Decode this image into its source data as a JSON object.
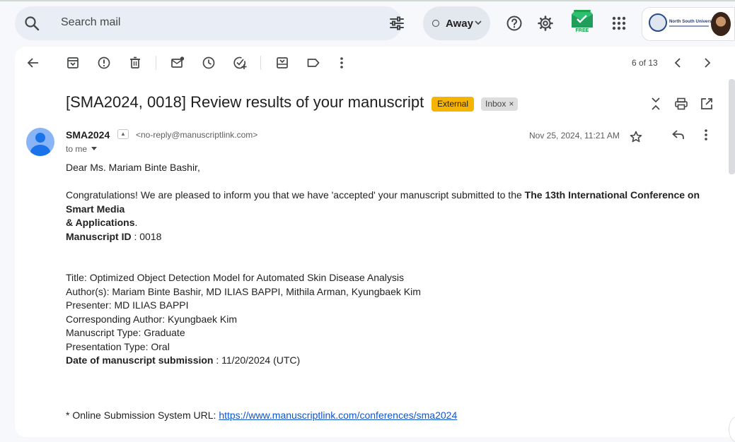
{
  "header": {
    "search_placeholder": "Search mail",
    "status": "Away",
    "free_badge": "FREE",
    "org_name": "North South University"
  },
  "toolbar": {
    "counter": "6 of 13"
  },
  "email": {
    "subject": "[SMA2024, 0018] Review results of your manuscript",
    "labels": {
      "external": "External",
      "inbox": "Inbox",
      "remove": "×"
    },
    "sender_name": "SMA2024",
    "sender_email": "<no-reply@manuscriptlink.com>",
    "recipient": "to me",
    "date": "Nov 25, 2024, 11:21 AM",
    "greeting": "Dear Ms. Mariam Binte Bashir,",
    "para1_text": "Congratulations! We are pleased to inform you that we have 'accepted' your manuscript submitted to the ",
    "para1_bold1": "The 13th International Conference on Smart Media",
    "para1_bold2": "& Applications",
    "para1_end": ".",
    "manuscript_id_label": "Manuscript ID",
    "manuscript_id_value": " : 0018",
    "details": [
      "Title: Optimized Object Detection Model for Automated Skin Disease Analysis",
      "Author(s): Mariam Binte Bashir, MD ILIAS BAPPI, Mithila Arman, Kyungbaek Kim",
      "Presenter: MD ILIAS BAPPI",
      "Corresponding Author: Kyungbaek Kim",
      "Manuscript Type: Graduate",
      "Presentation Type: Oral"
    ],
    "submission_label": "Date of manuscript submission",
    "submission_value": " : 11/20/2024 (UTC)",
    "url_label": "* Online Submission System URL: ",
    "url": "https://www.manuscriptlink.com/conferences/sma2024"
  },
  "colors": {
    "external_chip": "#f5b400",
    "link": "#1155cc",
    "avatar": "#8ab4f8"
  }
}
